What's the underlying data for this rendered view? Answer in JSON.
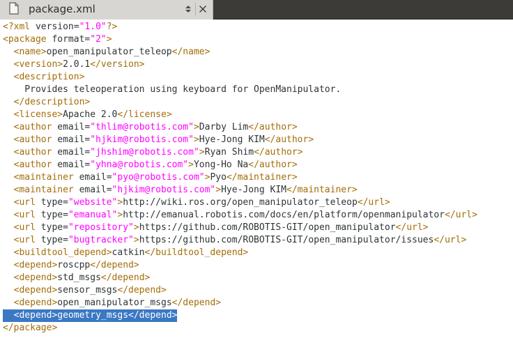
{
  "tab": {
    "title": "package.xml",
    "menu_icon": "chevron-updown-icon",
    "close_icon": "close-icon",
    "file_icon": "document-icon"
  },
  "colors": {
    "tag": "#a36d08",
    "attr_value": "#ff00ff",
    "text": "#2e3436",
    "selection": "#3b78c4"
  },
  "lines": [
    [
      "<?xml",
      " version=",
      "\"1.0\"",
      "?>"
    ],
    [
      "<package",
      " format=",
      "\"2\"",
      ">"
    ],
    [
      "  <name>",
      "open_manipulator_teleop",
      "</name>"
    ],
    [
      "  <version>",
      "2.0.1",
      "</version>"
    ],
    [
      "  <description>"
    ],
    [
      "    Provides teleoperation using keyboard for OpenManipulator."
    ],
    [
      "  </description>"
    ],
    [
      "  <license>",
      "Apache 2.0",
      "</license>"
    ],
    [
      "  <author",
      " email=",
      "\"thlim@robotis.com\"",
      ">",
      "Darby Lim",
      "</author>"
    ],
    [
      "  <author",
      " email=",
      "\"hjkim@robotis.com\"",
      ">",
      "Hye-Jong KIM",
      "</author>"
    ],
    [
      "  <author",
      " email=",
      "\"jhshim@robotis.com\"",
      ">",
      "Ryan Shim",
      "</author>"
    ],
    [
      "  <author",
      " email=",
      "\"yhna@robotis.com\"",
      ">",
      "Yong-Ho Na",
      "</author>"
    ],
    [
      "  <maintainer",
      " email=",
      "\"pyo@robotis.com\"",
      ">",
      "Pyo",
      "</maintainer>"
    ],
    [
      "  <maintainer",
      " email=",
      "\"hjkim@robotis.com\"",
      ">",
      "Hye-Jong KIM",
      "</maintainer>"
    ],
    [
      "  <url",
      " type=",
      "\"website\"",
      ">",
      "http://wiki.ros.org/open_manipulator_teleop",
      "</url>"
    ],
    [
      "  <url",
      " type=",
      "\"emanual\"",
      ">",
      "http://emanual.robotis.com/docs/en/platform/openmanipulator",
      "</url>"
    ],
    [
      "  <url",
      " type=",
      "\"repository\"",
      ">",
      "https://github.com/ROBOTIS-GIT/open_manipulator",
      "</url>"
    ],
    [
      "  <url",
      " type=",
      "\"bugtracker\"",
      ">",
      "https://github.com/ROBOTIS-GIT/open_manipulator/issues",
      "</url>"
    ],
    [
      "  <buildtool_depend>",
      "catkin",
      "</buildtool_depend>"
    ],
    [
      "  <depend>",
      "roscpp",
      "</depend>"
    ],
    [
      "  <depend>",
      "std_msgs",
      "</depend>"
    ],
    [
      "  <depend>",
      "sensor_msgs",
      "</depend>"
    ],
    [
      "  <depend>",
      "open_manipulator_msgs",
      "</depend>"
    ],
    [
      "  <depend>",
      "geometry_msgs",
      "</depend>"
    ],
    [
      "</package>"
    ]
  ],
  "selected_line": 23
}
